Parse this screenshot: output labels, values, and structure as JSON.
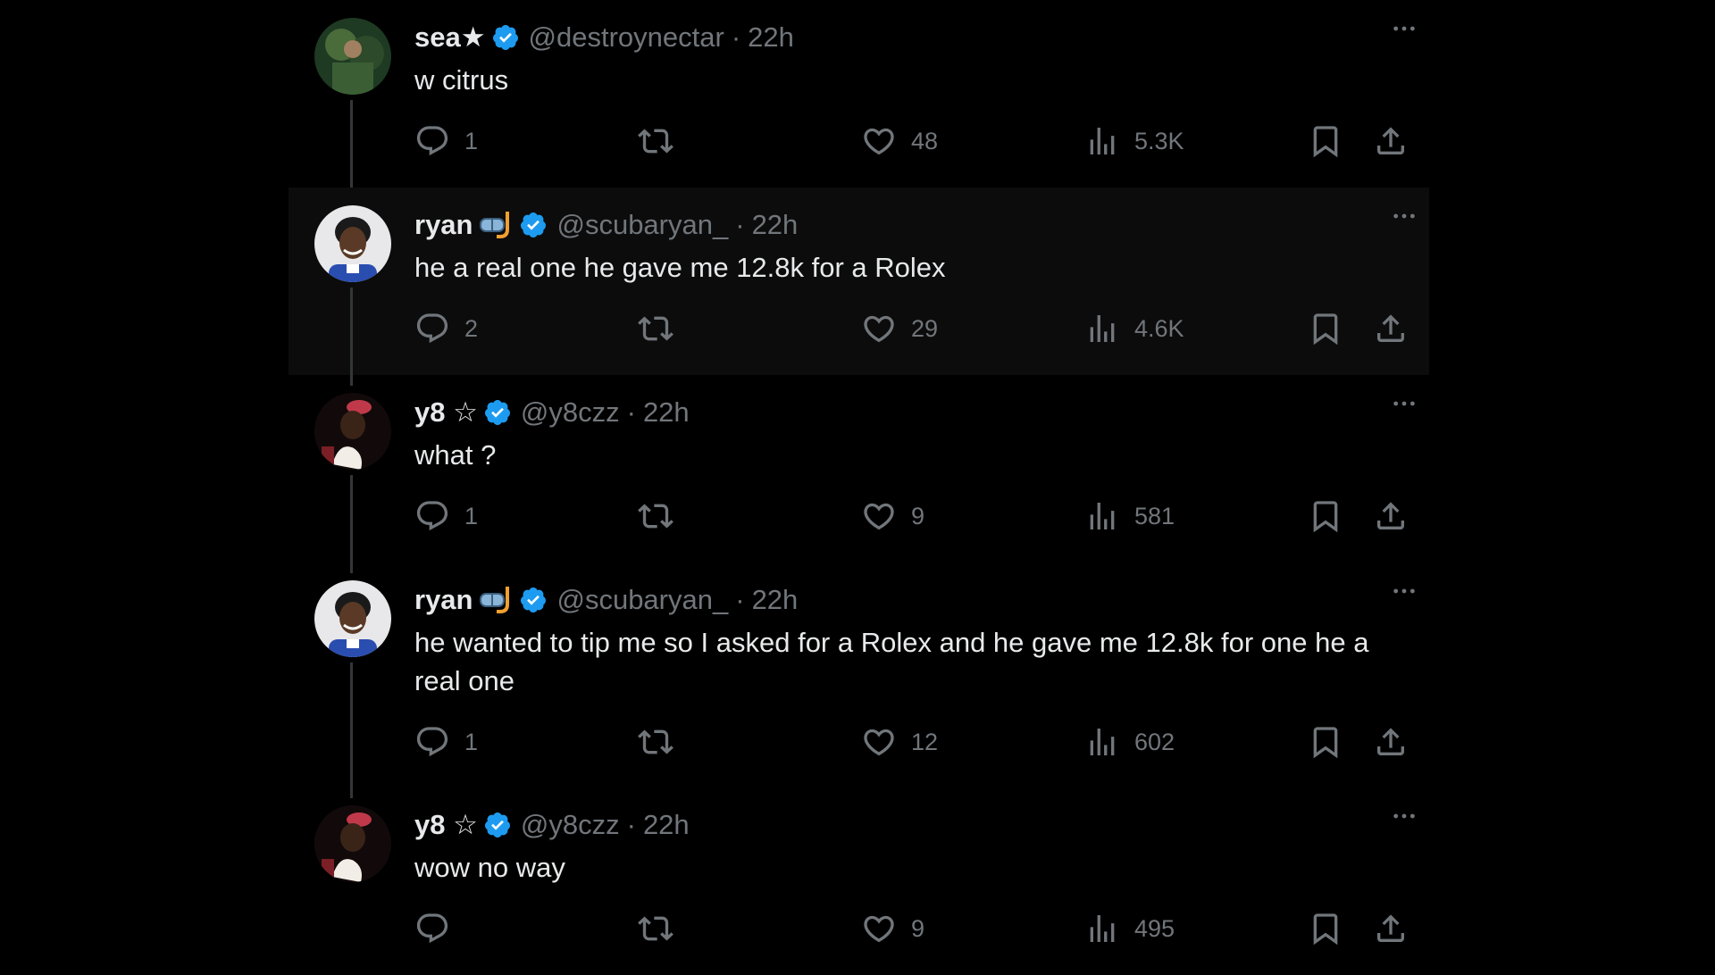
{
  "colors": {
    "background": "#000000",
    "text_primary": "#e7e9ea",
    "text_secondary": "#71767b",
    "verified_blue": "#1d9bf0",
    "thread_line": "#333639"
  },
  "tweets": [
    {
      "name": "sea★",
      "handle": "@destroynectar",
      "separator": "·",
      "time": "22h",
      "text": "w citrus",
      "replies": "1",
      "retweets": "",
      "likes": "48",
      "views": "5.3K",
      "avatar": "green-photo-avatar"
    },
    {
      "name": "ryan",
      "emoji": "diving-mask-snorkel-emoji",
      "handle": "@scubaryan_",
      "separator": "·",
      "time": "22h",
      "text": "he a real one he gave me 12.8k for a Rolex",
      "replies": "2",
      "retweets": "",
      "likes": "29",
      "views": "4.6K",
      "avatar": "smiling-man-avatar"
    },
    {
      "name": "y8 ☆",
      "handle": "@y8czz",
      "separator": "·",
      "time": "22h",
      "text": "what ?",
      "replies": "1",
      "retweets": "",
      "likes": "9",
      "views": "581",
      "avatar": "red-hat-avatar"
    },
    {
      "name": "ryan",
      "emoji": "diving-mask-snorkel-emoji",
      "handle": "@scubaryan_",
      "separator": "·",
      "time": "22h",
      "text": "he wanted to tip me so I asked for a Rolex and he gave me 12.8k for one he a real one",
      "replies": "1",
      "retweets": "",
      "likes": "12",
      "views": "602",
      "avatar": "smiling-man-avatar"
    },
    {
      "name": "y8 ☆",
      "handle": "@y8czz",
      "separator": "·",
      "time": "22h",
      "text": "wow no way",
      "replies": "",
      "retweets": "",
      "likes": "9",
      "views": "495",
      "avatar": "red-hat-avatar"
    }
  ]
}
